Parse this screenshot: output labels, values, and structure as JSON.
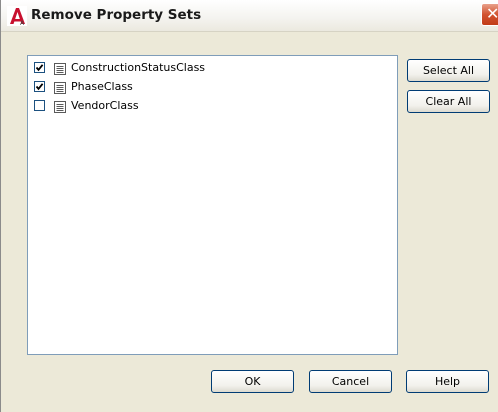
{
  "window": {
    "title": "Remove Property Sets",
    "close_glyph": "✕"
  },
  "property_sets": [
    {
      "name": "ConstructionStatusClass",
      "checked": true
    },
    {
      "name": "PhaseClass",
      "checked": true
    },
    {
      "name": "VendorClass",
      "checked": false
    }
  ],
  "side_buttons": {
    "select_all": "Select All",
    "clear_all": "Clear All"
  },
  "footer_buttons": {
    "ok": "OK",
    "cancel": "Cancel",
    "help": "Help"
  },
  "colors": {
    "app_icon": "#c8102e",
    "close_button": "#d2522f"
  }
}
